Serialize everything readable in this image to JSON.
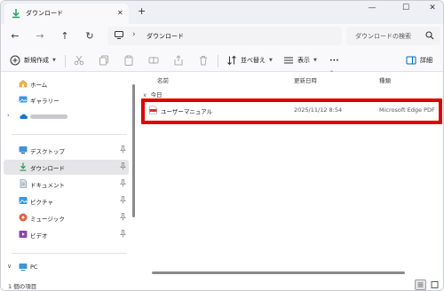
{
  "window": {
    "tab_title": "ダウンロード",
    "new_tab_label": "+",
    "minimize_label": "—",
    "maximize_label": "☐",
    "close_label": "✕"
  },
  "address_bar": {
    "breadcrumb_separator": "›",
    "breadcrumb": [
      "ダウンロード"
    ]
  },
  "search": {
    "placeholder": "ダウンロードの検索"
  },
  "toolbar": {
    "new_label": "新規作成",
    "sort_label": "並べ替え",
    "view_label": "表示",
    "more_label": "•••",
    "details_label": "詳細"
  },
  "sidebar": {
    "quick": [
      {
        "label": "ホーム",
        "icon": "home-icon"
      },
      {
        "label": "ギャラリー",
        "icon": "gallery-icon"
      }
    ],
    "cloud": {
      "expander": "›",
      "icon": "onedrive-icon"
    },
    "pinned": [
      {
        "label": "デスクトップ",
        "icon": "desktop-icon",
        "selected": false
      },
      {
        "label": "ダウンロード",
        "icon": "download-icon",
        "selected": true
      },
      {
        "label": "ドキュメント",
        "icon": "documents-icon",
        "selected": false
      },
      {
        "label": "ピクチャ",
        "icon": "pictures-icon",
        "selected": false
      },
      {
        "label": "ミュージック",
        "icon": "music-icon",
        "selected": false
      },
      {
        "label": "ビデオ",
        "icon": "videos-icon",
        "selected": false
      }
    ],
    "pc": {
      "expander": "∨",
      "label": "PC",
      "icon": "pc-icon"
    }
  },
  "file_list": {
    "columns": [
      "名前",
      "更新日時",
      "種類"
    ],
    "groups": [
      {
        "label": "今日",
        "files": [
          {
            "name": "ユーザーマニュアル",
            "modified": "2025/11/12 8:54",
            "type": "Microsoft Edge PDF",
            "icon": "pdf-icon"
          }
        ]
      }
    ]
  },
  "status": {
    "item_count": "1 個の項目"
  },
  "colors": {
    "accent": "#0067c0",
    "highlight_box": "#e00000",
    "selected_bg": "#e5e5e8",
    "pdf_red": "#d13438"
  }
}
